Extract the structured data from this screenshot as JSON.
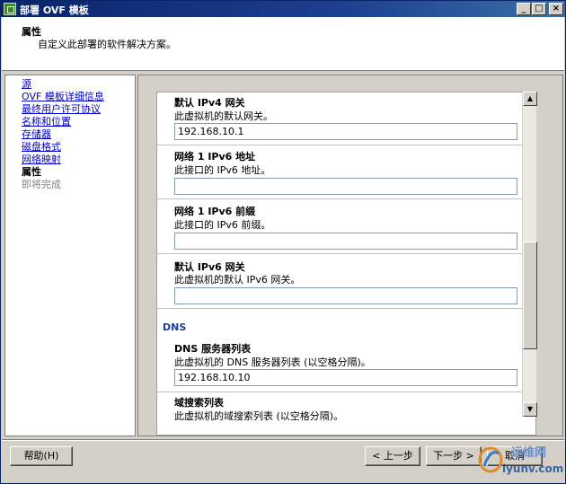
{
  "window": {
    "title": "部署 OVF 模板",
    "controls": {
      "minimize": "_",
      "maximize": "□",
      "close": "×"
    }
  },
  "header": {
    "title": "属性",
    "subtitle": "自定义此部署的软件解决方案。"
  },
  "nav": {
    "items": [
      {
        "label": "源",
        "state": "link"
      },
      {
        "label": "OVF 模板详细信息",
        "state": "link"
      },
      {
        "label": "最终用户许可协议",
        "state": "link"
      },
      {
        "label": "名称和位置",
        "state": "link"
      },
      {
        "label": "存储器",
        "state": "link"
      },
      {
        "label": "磁盘格式",
        "state": "link"
      },
      {
        "label": "网络映射",
        "state": "link"
      },
      {
        "label": "属性",
        "state": "current"
      },
      {
        "label": "即将完成",
        "state": "disabled"
      }
    ]
  },
  "properties": {
    "ipv4_gateway": {
      "title": "默认 IPv4 网关",
      "desc": "此虚拟机的默认网关。",
      "value": "192.168.10.1"
    },
    "ipv6_address": {
      "title": "网络 1 IPv6 地址",
      "desc": "此接口的 IPv6 地址。",
      "value": ""
    },
    "ipv6_prefix": {
      "title": "网络 1 IPv6 前缀",
      "desc": "此接口的 IPv6 前缀。",
      "value": ""
    },
    "ipv6_gateway": {
      "title": "默认 IPv6 网关",
      "desc": "此虚拟机的默认 IPv6 网关。",
      "value": ""
    },
    "dns_group": "DNS",
    "dns_servers": {
      "title": "DNS 服务器列表",
      "desc": "此虚拟机的 DNS 服务器列表 (以空格分隔)。",
      "value": "192.168.10.10"
    },
    "search_domains": {
      "title": "域搜索列表",
      "desc": "此虚拟机的域搜索列表 (以空格分隔)。"
    }
  },
  "scrollbar": {
    "up": "▲",
    "down": "▼"
  },
  "buttons": {
    "help": "帮助(H)",
    "back": "< 上一步",
    "next": "下一步 >",
    "cancel": "取消"
  },
  "watermark": {
    "line1": "运维网",
    "line2": "iyunv.com"
  }
}
